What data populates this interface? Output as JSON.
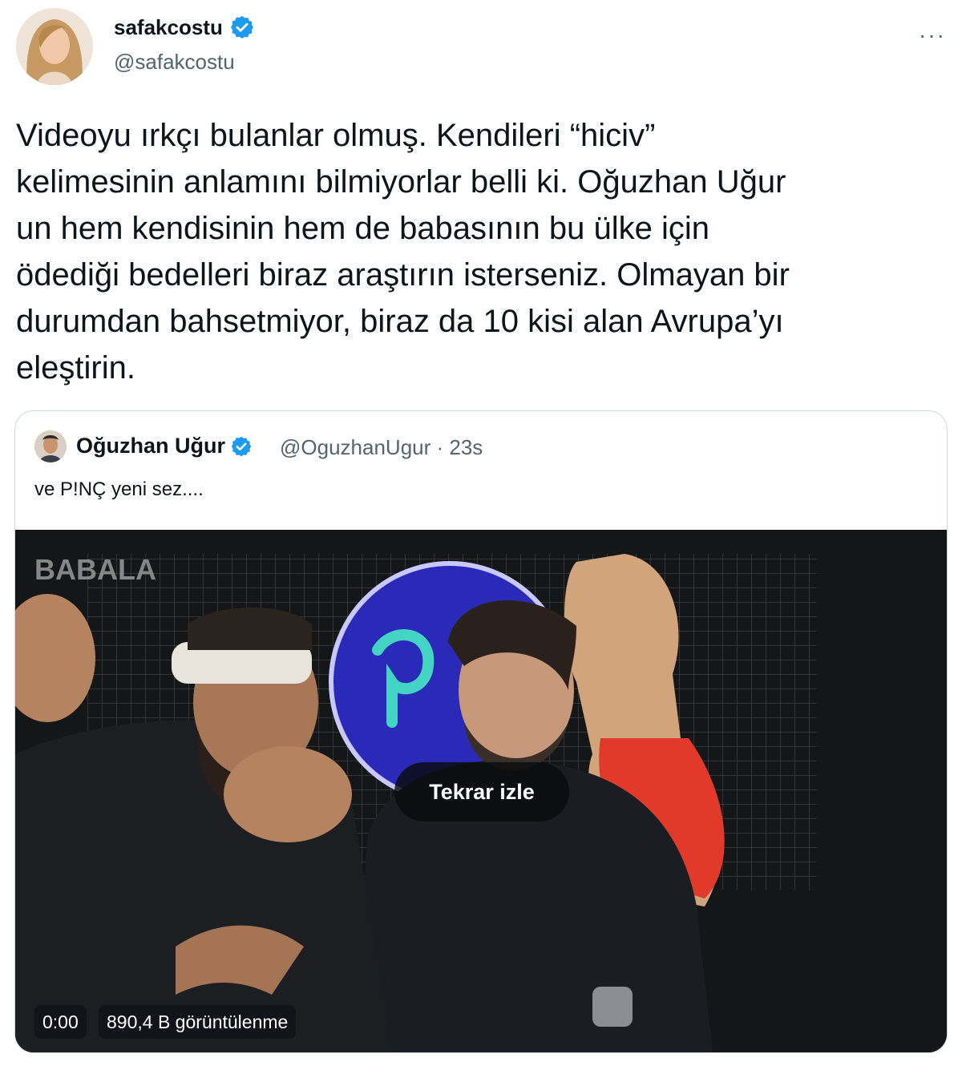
{
  "author": {
    "display_name": "safakcostu",
    "handle": "@safakcostu",
    "verified": true,
    "verified_icon": "verified-badge-icon"
  },
  "menu_icon": "more-options-icon",
  "more_label": "···",
  "tweet": {
    "lines": [
      "Videoyu ırkçı bulanlar olmuş. Kendileri “hiciv”",
      "kelimesinin anlamını bilmiyorlar belli ki. Oğuzhan Uğur",
      "un hem kendisinin hem de babasının bu ülke için",
      "ödediği bedelleri biraz araştırın isterseniz. Olmayan bir",
      "durumdan bahsetmiyor, biraz da 10 kisi alan Avrupa’yı",
      "eleştirin."
    ]
  },
  "quoted_tweet": {
    "display_name": "Oğuzhan Uğur",
    "meta": "@OguzhanUgur · 23s",
    "text": "ve P!NÇ yeni sez....",
    "video": {
      "watermark": "BABALA",
      "replay_label": "Tekrar izle",
      "time": "0:00",
      "views": "890,4 B görüntülenme"
    }
  },
  "colors": {
    "text": "#0f1419",
    "secondary": "#536471",
    "verified_blue": "#1d9bf0",
    "border": "#cfd9de"
  }
}
